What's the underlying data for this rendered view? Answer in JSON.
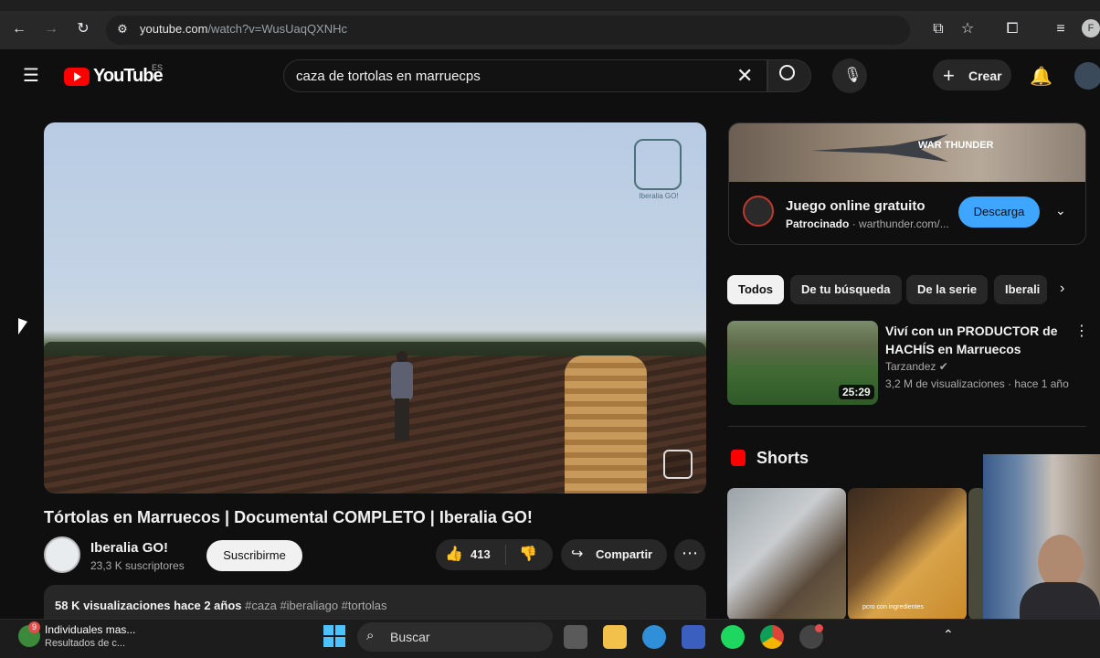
{
  "browser": {
    "url_host": "youtube.com",
    "url_path": "/watch?v=WusUaqQXNHc",
    "profile_initial": "F"
  },
  "header": {
    "logo_text": "YouTube",
    "country_code": "ES",
    "search_value": "caza de tortolas en marruecps",
    "create_label": "Crear"
  },
  "video": {
    "title": "Tórtolas en Marruecos | Documental COMPLETO | Iberalia GO!",
    "watermark": "Iberalia GO!",
    "channel_name": "Iberalia GO!",
    "channel_subs": "23,3 K suscriptores",
    "subscribe_label": "Suscribirme",
    "likes": "413",
    "share_label": "Compartir",
    "views": "58 K visualizaciones",
    "age": "hace 2 años",
    "hashtags": "#caza #iberaliago #tortolas"
  },
  "ad": {
    "title": "Juego online gratuito",
    "sponsored": "Patrocinado",
    "domain": "· warthunder.com/...",
    "button": "Descarga",
    "banner_text": "WAR THUNDER"
  },
  "chips": [
    "Todos",
    "De tu búsqueda",
    "De la serie",
    "Iberali"
  ],
  "recommendation": {
    "title": "Viví con un PRODUCTOR de HACHÍS en Marruecos",
    "channel": "Tarzandez",
    "meta": "3,2 M de visualizaciones · hace 1 año",
    "duration": "25:29"
  },
  "shorts": {
    "title": "Shorts",
    "caption": "pcro con ingredientes"
  },
  "taskbar": {
    "notif_title": "Individuales mas...",
    "notif_sub": "Resultados de c...",
    "notif_badge": "9",
    "search_label": "Buscar"
  },
  "colors": {
    "background": "#0f0f0f",
    "brand_red": "#ff0000",
    "ad_button": "#3ea6ff"
  }
}
